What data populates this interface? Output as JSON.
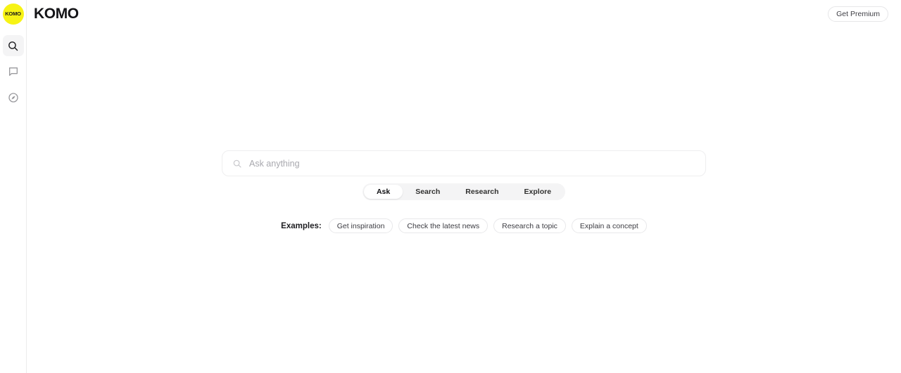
{
  "sidebar": {
    "logo": {
      "text": "KOMO",
      "bg_color": "#f7f315",
      "icon": "komo-logo-icon"
    },
    "items": [
      {
        "label": "Search",
        "icon": "search-icon",
        "active": true
      },
      {
        "label": "Chat",
        "icon": "chat-bubble-icon",
        "active": false
      },
      {
        "label": "Explore",
        "icon": "compass-icon",
        "active": false
      }
    ]
  },
  "header": {
    "wordmark": "KOMO",
    "premium_label": "Get Premium"
  },
  "search": {
    "placeholder": "Ask anything",
    "value": "",
    "icon": "search-icon"
  },
  "tabs": [
    {
      "label": "Ask",
      "active": true
    },
    {
      "label": "Search",
      "active": false
    },
    {
      "label": "Research",
      "active": false
    },
    {
      "label": "Explore",
      "active": false
    }
  ],
  "examples": {
    "label": "Examples:",
    "chips": [
      {
        "label": "Get inspiration"
      },
      {
        "label": "Check the latest news"
      },
      {
        "label": "Research a topic"
      },
      {
        "label": "Explain a concept"
      }
    ]
  },
  "colors": {
    "brand_yellow": "#f7f315",
    "text_primary": "#141417",
    "text_muted": "#a8a8ae",
    "border": "#ececec",
    "track": "#f4f4f5"
  }
}
